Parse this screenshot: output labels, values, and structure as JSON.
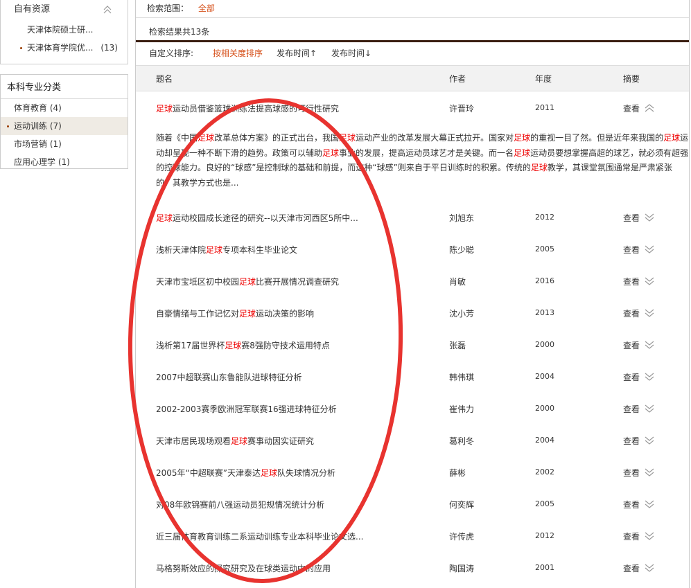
{
  "sidebar": {
    "own_resources": {
      "title": "自有资源",
      "items": [
        {
          "label": "天津体院硕士研...",
          "count": ""
        },
        {
          "label": "天津体育学院优...",
          "count": "(13)"
        }
      ]
    },
    "major": {
      "title": "本科专业分类",
      "items": [
        {
          "label": "体育教育",
          "count": "(4)"
        },
        {
          "label": "运动训练",
          "count": "(7)"
        },
        {
          "label": "市场营销",
          "count": "(1)"
        },
        {
          "label": "应用心理学",
          "count": "(1)"
        }
      ]
    }
  },
  "scope": {
    "label": "检索范围：",
    "value": "全部"
  },
  "result_count": "检索结果共13条",
  "sort": {
    "label": "自定义排序:",
    "relevance": "按相关度排序",
    "time_asc": "发布时间↑",
    "time_desc": "发布时间↓"
  },
  "table": {
    "headers": {
      "title": "题名",
      "author": "作者",
      "year": "年度",
      "abstract": "摘要"
    },
    "view_label": "查看",
    "highlight_term": "足球",
    "rows": [
      {
        "title": "足球运动员借鉴篮球训练法提高球感的可行性研究",
        "author": "许晋玲",
        "year": "2011",
        "expanded": true
      },
      {
        "title": "足球运动校园成长途径的研究--以天津市河西区5所中...",
        "author": "刘旭东",
        "year": "2012"
      },
      {
        "title": "浅析天津体院足球专项本科生毕业论文",
        "author": "陈少聪",
        "year": "2005"
      },
      {
        "title": "天津市宝坻区初中校园足球比赛开展情况调查研究",
        "author": "肖敏",
        "year": "2016"
      },
      {
        "title": "自豪情绪与工作记忆对足球运动决策的影响",
        "author": "沈小芳",
        "year": "2013"
      },
      {
        "title": "浅析第17届世界杯足球赛8强防守技术运用特点",
        "author": "张磊",
        "year": "2000"
      },
      {
        "title": "2007中超联赛山东鲁能队进球特征分析",
        "author": "韩伟琪",
        "year": "2004"
      },
      {
        "title": "2002-2003赛季欧洲冠军联赛16强进球特征分析",
        "author": "崔伟力",
        "year": "2000"
      },
      {
        "title": "天津市居民现场观看足球赛事动因实证研究",
        "author": "葛利冬",
        "year": "2004"
      },
      {
        "title": "2005年“中超联赛”天津泰达足球队失球情况分析",
        "author": "薛彬",
        "year": "2002"
      },
      {
        "title": "对08年欧锦赛前八强运动员犯规情况统计分析",
        "author": "何奕辉",
        "year": "2005"
      },
      {
        "title": "近三届体育教育训练二系运动训练专业本科毕业论文选...",
        "author": "许传虎",
        "year": "2012"
      },
      {
        "title": "马格努斯效应的探究研究及在球类运动中的应用",
        "author": "陶国涛",
        "year": "2001"
      }
    ],
    "abstract_lines": [
      "随着《中国足球改革总体方案》的正式出台，我国足球运动产业的改革发展大幕正式拉开。国家对足球的重视一目了然。但是近年来我国的足球运",
      "动却呈现一种不断下滑的趋势。政策可以辅助足球事业的发展，提高运动员球艺才是关键。而一名足球运动员要想掌握高超的球艺，就必须有超强",
      "的控球能力。良好的“球感”是控制球的基础和前提，而这种“球感”则来自于平日训练时的积累。传统的足球教学，其课堂氛围通常是严肃紧张",
      "的，其教学方式也是..."
    ]
  },
  "colors": {
    "accent": "#d6501a",
    "highlight": "#e00000",
    "annotation": "#e8332f",
    "rule": "#3a1e10"
  },
  "icons": {
    "collapse": "chevron-up-icon",
    "expand": "double-chevron-down-icon"
  }
}
